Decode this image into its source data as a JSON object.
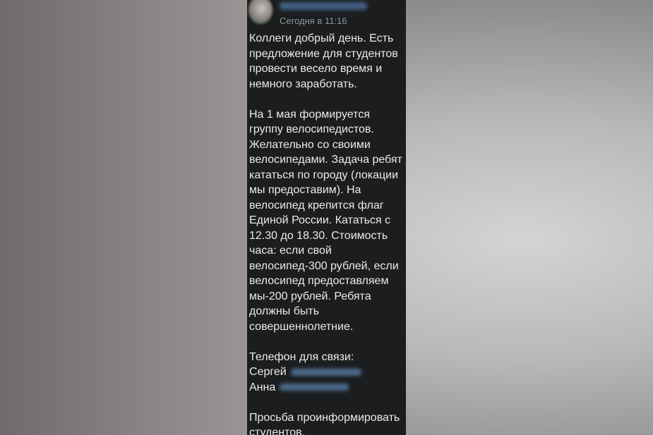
{
  "post": {
    "time": "Сегодня в 11:16",
    "paragraph1": [
      "Коллеги добрый день. Есть",
      "предложение для студентов",
      "провести весело время и",
      "немного заработать."
    ],
    "paragraph2": [
      "На 1 мая формируется",
      "группу велосипедистов.",
      "Желательно со своими",
      "велосипедами. Задача ребят",
      "кататься по городу (локации",
      "мы предоставим). На",
      "велосипед крепится флаг",
      "Единой России. Кататься с",
      "12.30 до 18.30. Стоимость",
      "часа: если свой",
      "велосипед-300 рублей, если",
      "велосипед предоставляем",
      "мы-200 рублей. Ребята",
      "должны быть",
      "совершеннолетние."
    ],
    "contacts": {
      "heading": "Телефон для связи:",
      "contact1_name": "Сергей",
      "contact2_name": "Анна"
    },
    "paragraph4": [
      "Просьба проинформировать",
      "студентов."
    ]
  }
}
